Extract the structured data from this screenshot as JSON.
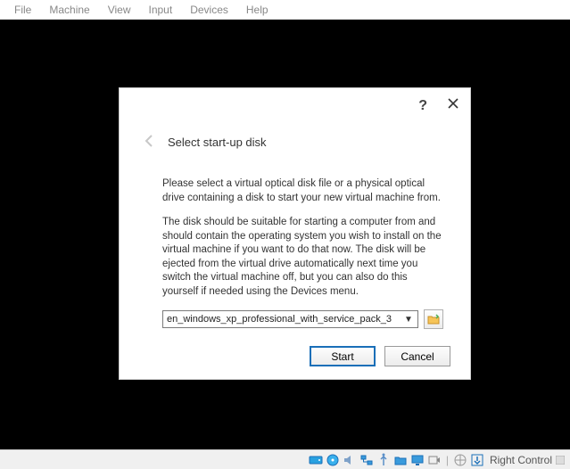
{
  "menubar": {
    "items": [
      "File",
      "Machine",
      "View",
      "Input",
      "Devices",
      "Help"
    ]
  },
  "dialog": {
    "title": "Select start-up disk",
    "para1": "Please select a virtual optical disk file or a physical optical drive containing a disk to start your new virtual machine from.",
    "para2": "The disk should be suitable for starting a computer from and should contain the operating system you wish to install on the virtual machine if you want to do that now. The disk will be ejected from the virtual drive automatically next time you switch the virtual machine off, but you can also do this yourself if needed using the Devices menu.",
    "selected_iso": "en_windows_xp_professional_with_service_pack_3",
    "start_label": "Start",
    "cancel_label": "Cancel"
  },
  "statusbar": {
    "host_key_label": "Right Control"
  }
}
